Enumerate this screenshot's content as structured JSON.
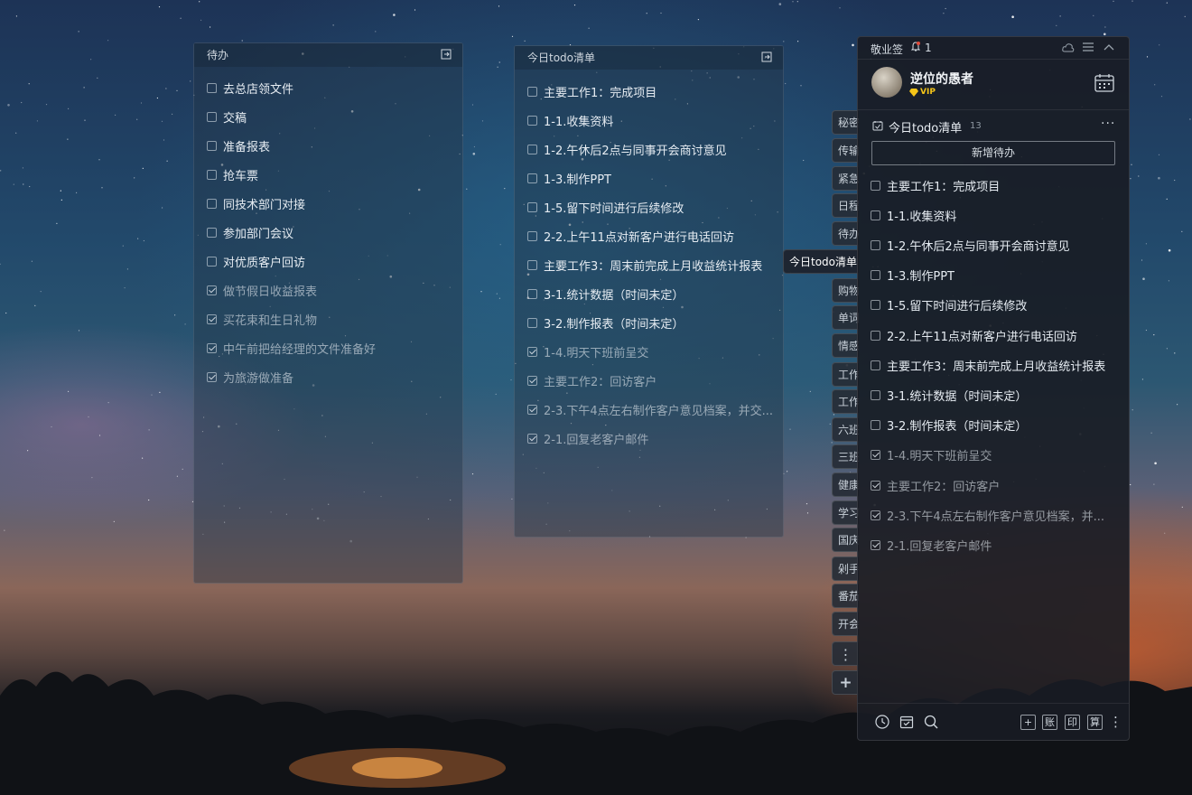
{
  "panel_left": {
    "title": "待办",
    "items": [
      {
        "text": "去总店领文件",
        "done": false
      },
      {
        "text": "交稿",
        "done": false
      },
      {
        "text": "准备报表",
        "done": false
      },
      {
        "text": "抢车票",
        "done": false
      },
      {
        "text": "同技术部门对接",
        "done": false
      },
      {
        "text": "参加部门会议",
        "done": false
      },
      {
        "text": "对优质客户回访",
        "done": false
      },
      {
        "text": "做节假日收益报表",
        "done": true
      },
      {
        "text": "买花束和生日礼物",
        "done": true
      },
      {
        "text": "中午前把给经理的文件准备好",
        "done": true
      },
      {
        "text": "为旅游做准备",
        "done": true
      }
    ]
  },
  "panel_middle": {
    "title": "今日todo清单",
    "items": [
      {
        "text": "主要工作1：完成项目",
        "done": false
      },
      {
        "text": "1-1.收集资料",
        "done": false
      },
      {
        "text": "1-2.午休后2点与同事开会商讨意见",
        "done": false
      },
      {
        "text": "1-3.制作PPT",
        "done": false
      },
      {
        "text": "1-5.留下时间进行后续修改",
        "done": false
      },
      {
        "text": "2-2.上午11点对新客户进行电话回访",
        "done": false
      },
      {
        "text": "主要工作3：周末前完成上月收益统计报表",
        "done": false
      },
      {
        "text": "3-1.统计数据（时间未定）",
        "done": false
      },
      {
        "text": "3-2.制作报表（时间未定）",
        "done": false
      },
      {
        "text": "1-4.明天下班前呈交",
        "done": true
      },
      {
        "text": "主要工作2：回访客户",
        "done": true
      },
      {
        "text": "2-3.下午4点左右制作客户意见档案，并交...",
        "done": true
      },
      {
        "text": "2-1.回复老客户邮件",
        "done": true
      }
    ]
  },
  "app": {
    "name": "敬业签",
    "notification_count": "1",
    "user_name": "逆位的愚者",
    "vip_label": "VIP",
    "list_title": "今日todo清单",
    "list_count": "13",
    "add_button": "新增待办",
    "items": [
      {
        "text": "主要工作1：完成项目",
        "done": false
      },
      {
        "text": "1-1.收集资料",
        "done": false
      },
      {
        "text": "1-2.午休后2点与同事开会商讨意见",
        "done": false
      },
      {
        "text": "1-3.制作PPT",
        "done": false
      },
      {
        "text": "1-5.留下时间进行后续修改",
        "done": false
      },
      {
        "text": "2-2.上午11点对新客户进行电话回访",
        "done": false
      },
      {
        "text": "主要工作3：周末前完成上月收益统计报表",
        "done": false
      },
      {
        "text": "3-1.统计数据（时间未定）",
        "done": false
      },
      {
        "text": "3-2.制作报表（时间未定）",
        "done": false
      },
      {
        "text": "1-4.明天下班前呈交",
        "done": true
      },
      {
        "text": "主要工作2：回访客户",
        "done": true
      },
      {
        "text": "2-3.下午4点左右制作客户意见档案，并...",
        "done": true
      },
      {
        "text": "2-1.回复老客户邮件",
        "done": true
      }
    ],
    "bottom_tools": {
      "add": "+",
      "account": "账",
      "print": "印",
      "calc": "算"
    }
  },
  "side_tabs": [
    {
      "label": "秘密",
      "active": false
    },
    {
      "label": "传输",
      "active": false
    },
    {
      "label": "紧急",
      "active": false
    },
    {
      "label": "日程",
      "active": false
    },
    {
      "label": "待办",
      "active": false
    },
    {
      "label": "今日todo清单",
      "active": true
    },
    {
      "label": "购物",
      "active": false
    },
    {
      "label": "单词",
      "active": false
    },
    {
      "label": "情感",
      "active": false
    },
    {
      "label": "工作",
      "active": false
    },
    {
      "label": "工作",
      "active": false
    },
    {
      "label": "六班",
      "active": false
    },
    {
      "label": "三班",
      "active": false
    },
    {
      "label": "健康",
      "active": false
    },
    {
      "label": "学习",
      "active": false
    },
    {
      "label": "国庆",
      "active": false
    },
    {
      "label": "剁手",
      "active": false
    },
    {
      "label": "番茄",
      "active": false
    },
    {
      "label": "开会",
      "active": false
    }
  ],
  "colors": {
    "vip": "#f5c518",
    "badge": "#e14b3b",
    "accent": "#2c3a4a"
  }
}
